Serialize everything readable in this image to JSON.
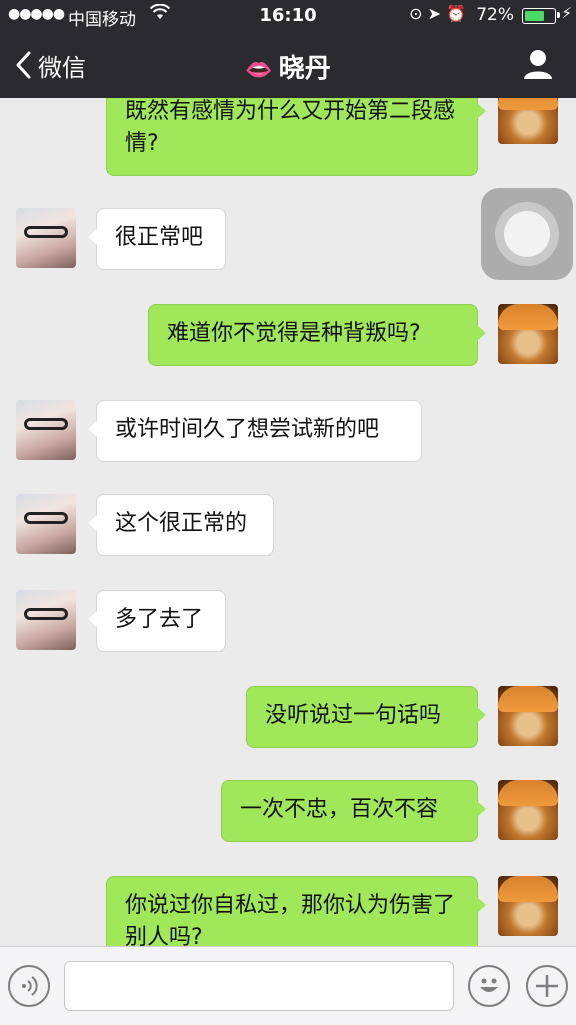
{
  "status_bar": {
    "signal": "●●●●●",
    "carrier": "中国移动",
    "time": "16:10",
    "battery_percent": "72%",
    "battery_level": 0.72
  },
  "nav": {
    "back_label": "微信",
    "contact_emoji": "👄",
    "contact_name": "晓丹"
  },
  "messages": [
    {
      "sender": "self",
      "text": "既然有感情为什么又开始第二段感情?"
    },
    {
      "sender": "other",
      "text": "很正常吧"
    },
    {
      "sender": "self",
      "text": "难道你不觉得是种背叛吗?"
    },
    {
      "sender": "other",
      "text": "或许时间久了想尝试新的吧"
    },
    {
      "sender": "other",
      "text": "这个很正常的"
    },
    {
      "sender": "other",
      "text": "多了去了"
    },
    {
      "sender": "self",
      "text": "没听说过一句话吗"
    },
    {
      "sender": "self",
      "text": "一次不忠，百次不容"
    },
    {
      "sender": "self",
      "text": "你说过你自私过，那你认为伤害了别人吗?"
    }
  ],
  "input": {
    "value": ""
  },
  "colors": {
    "nav_bg": "#2b2a2f",
    "chat_bg": "#ebebeb",
    "self_bubble": "#a0e75a",
    "other_bubble": "#ffffff"
  },
  "icons": {
    "back": "chevron-left-icon",
    "profile": "person-icon",
    "voice": "voice-icon",
    "emoji": "emoji-icon",
    "plus": "plus-icon"
  }
}
